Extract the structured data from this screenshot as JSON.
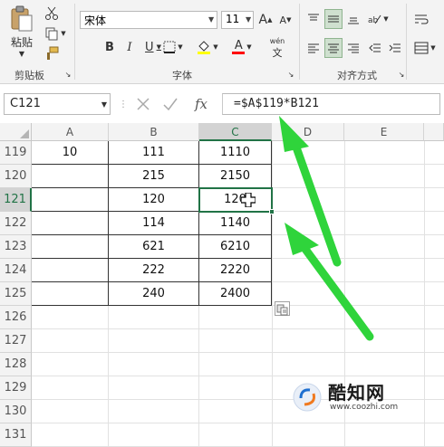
{
  "ribbon": {
    "clipboard": {
      "paste_label": "粘贴",
      "group_label": "剪贴板"
    },
    "font": {
      "font_name": "宋体",
      "font_size": "11",
      "grow_label": "A",
      "shrink_label": "A",
      "bold_label": "B",
      "italic_label": "I",
      "underline_label": "U",
      "font_color_label": "A",
      "phonetic_label": "文",
      "group_label": "字体"
    },
    "alignment": {
      "group_label": "对齐方式"
    }
  },
  "formula_bar": {
    "name_box": "C121",
    "fx_label": "fx",
    "formula": "=$A$119*B121"
  },
  "columns": [
    "A",
    "B",
    "C",
    "D",
    "E"
  ],
  "rows": [
    {
      "num": "119",
      "A": "10",
      "B": "111",
      "C": "1110"
    },
    {
      "num": "120",
      "A": "",
      "B": "215",
      "C": "2150"
    },
    {
      "num": "121",
      "A": "",
      "B": "120",
      "C": "120"
    },
    {
      "num": "122",
      "A": "",
      "B": "114",
      "C": "1140"
    },
    {
      "num": "123",
      "A": "",
      "B": "621",
      "C": "6210"
    },
    {
      "num": "124",
      "A": "",
      "B": "222",
      "C": "2220"
    },
    {
      "num": "125",
      "A": "",
      "B": "240",
      "C": "2400"
    },
    {
      "num": "126",
      "A": "",
      "B": "",
      "C": ""
    },
    {
      "num": "127",
      "A": "",
      "B": "",
      "C": ""
    },
    {
      "num": "128",
      "A": "",
      "B": "",
      "C": ""
    },
    {
      "num": "129",
      "A": "",
      "B": "",
      "C": ""
    },
    {
      "num": "130",
      "A": "",
      "B": "",
      "C": ""
    },
    {
      "num": "131",
      "A": "",
      "B": "",
      "C": ""
    }
  ],
  "selection": {
    "name": "C121",
    "active_column": "C",
    "active_row": "121"
  },
  "watermark": {
    "brand": "酷知网",
    "url": "www.coozhi.com"
  },
  "colors": {
    "excel_green": "#217346",
    "annotation_arrow": "#2fd43b",
    "ribbon_bg": "#f3f3f3"
  }
}
